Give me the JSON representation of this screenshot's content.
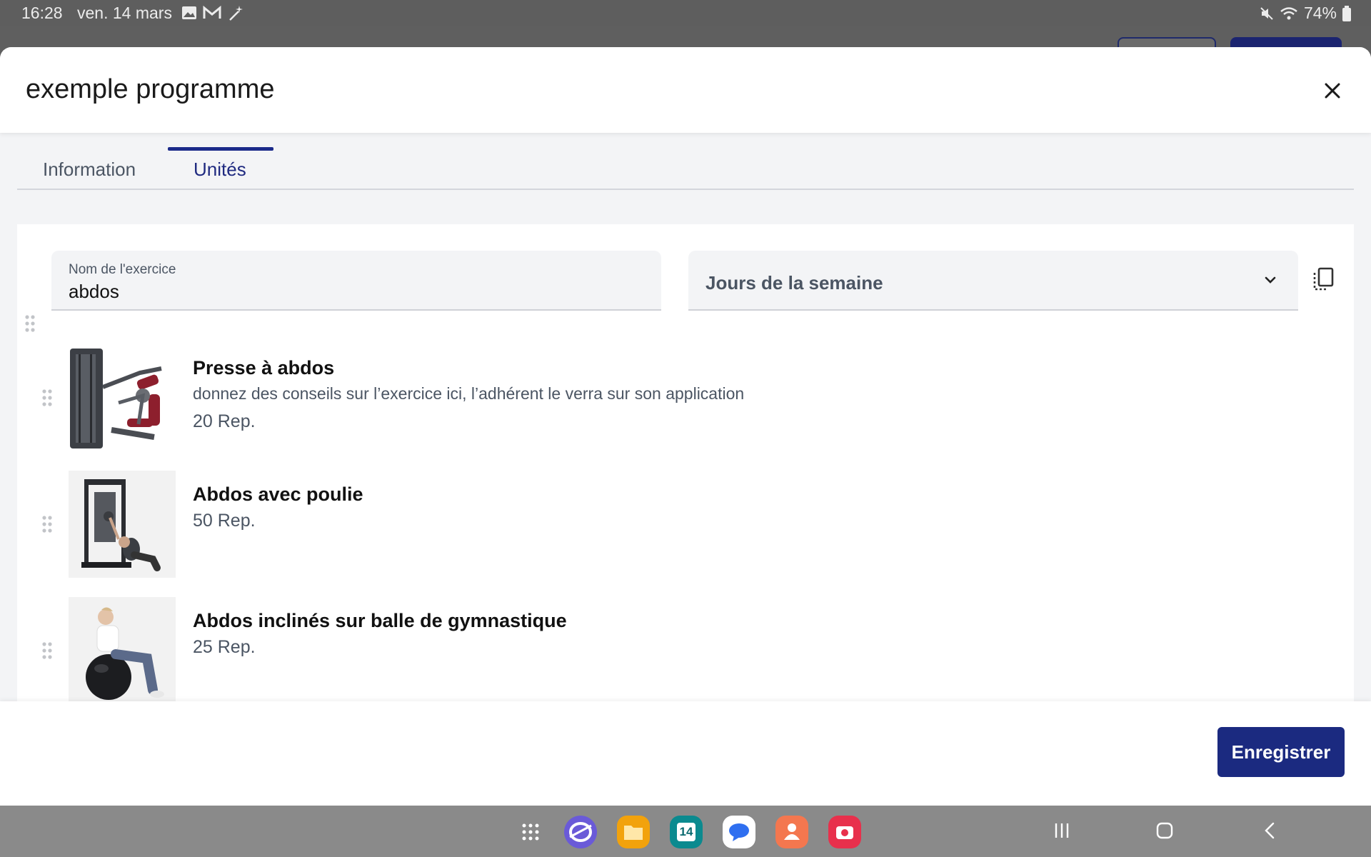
{
  "status_bar": {
    "time": "16:28",
    "date": "ven. 14 mars",
    "battery": "74%"
  },
  "modal": {
    "title": "exemple programme",
    "tabs": [
      {
        "label": "Information",
        "active": false
      },
      {
        "label": "Unités",
        "active": true
      }
    ],
    "exercise_name_field": {
      "label": "Nom de l'exercice",
      "value": "abdos"
    },
    "days_select": {
      "placeholder": "Jours de la semaine"
    },
    "exercises": [
      {
        "title": "Presse à abdos",
        "description": "donnez des conseils sur l’exercice ici, l’adhérent le verra sur son application",
        "reps": "20 Rep."
      },
      {
        "title": "Abdos avec poulie",
        "reps": "50 Rep."
      },
      {
        "title": "Abdos inclinés sur balle de gymnastique",
        "reps": "25 Rep."
      }
    ],
    "save_label": "Enregistrer"
  },
  "dock": {
    "calendar_day": "14",
    "apps": [
      "apps-grid-icon",
      "internet-icon",
      "files-icon",
      "calendar-icon",
      "messages-icon",
      "contacts-icon",
      "camera-icon"
    ]
  },
  "colors": {
    "primary": "#1b2a80",
    "tab_active": "#1f2a80",
    "status_bar_bg": "#5e5e5e",
    "nav_bar_bg": "#8a8a8a"
  }
}
